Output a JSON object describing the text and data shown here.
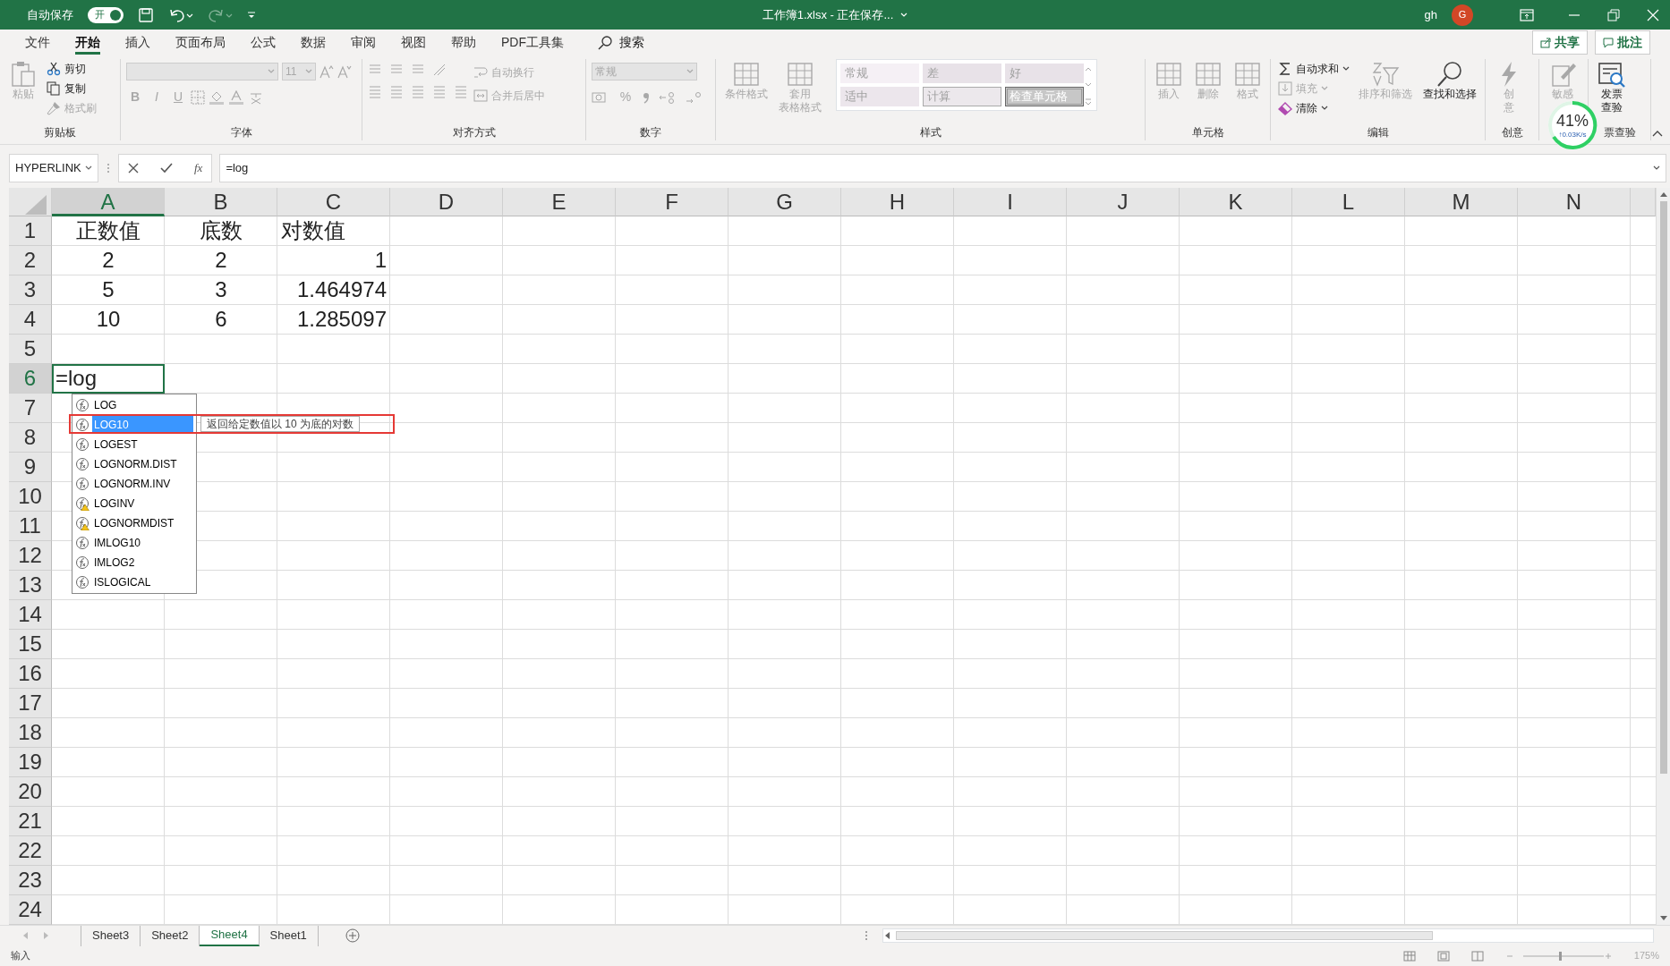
{
  "title_bar": {
    "autosave_label": "自动保存",
    "autosave": {
      "label": "开",
      "on": true
    },
    "title": "工作簿1.xlsx - 正在保存...",
    "user": "gh",
    "avatar": "G"
  },
  "menu": {
    "tabs": [
      {
        "label": "文件",
        "selected": false
      },
      {
        "label": "开始",
        "selected": true
      },
      {
        "label": "插入",
        "selected": false
      },
      {
        "label": "页面布局",
        "selected": false
      },
      {
        "label": "公式",
        "selected": false
      },
      {
        "label": "数据",
        "selected": false
      },
      {
        "label": "审阅",
        "selected": false
      },
      {
        "label": "视图",
        "selected": false
      },
      {
        "label": "帮助",
        "selected": false
      },
      {
        "label": "PDF工具集",
        "selected": false
      }
    ],
    "search": "搜索",
    "share": "共享",
    "comments": "批注"
  },
  "ribbon": {
    "groups": [
      {
        "kind": "clipboard",
        "label": "剪贴板",
        "large": {
          "lines": [
            "粘贴"
          ],
          "disabled": true
        },
        "small": [
          {
            "label": "剪切",
            "disabled": false
          },
          {
            "label": "复制",
            "disabled": false
          },
          {
            "label": "格式刷",
            "disabled": true
          }
        ]
      },
      {
        "kind": "font",
        "label": "字体",
        "font_size": "11",
        "glyphs": [
          "B",
          "I",
          "U"
        ]
      },
      {
        "kind": "alignment",
        "label": "对齐方式",
        "small": [
          {
            "label": "自动换行",
            "disabled": true
          },
          {
            "label": "合并后居中",
            "disabled": true
          }
        ]
      },
      {
        "kind": "number",
        "label": "数字",
        "format": "常规",
        "percent": "%"
      },
      {
        "kind": "styles",
        "label": "样式",
        "large": [
          {
            "lines": [
              "条件格式"
            ],
            "disabled": true
          },
          {
            "lines": [
              "套用",
              "表格格式"
            ],
            "disabled": true
          }
        ],
        "styles": [
          {
            "label": "常规",
            "kind": "normal"
          },
          {
            "label": "差",
            "kind": "bad"
          },
          {
            "label": "好",
            "kind": "good"
          },
          {
            "label": "适中",
            "kind": "neutral"
          },
          {
            "label": "计算",
            "kind": "calc"
          },
          {
            "label": "检查单元格",
            "kind": "check"
          }
        ]
      },
      {
        "kind": "large",
        "label": "单元格",
        "large": [
          {
            "lines": [
              "插入"
            ],
            "disabled": true
          },
          {
            "lines": [
              "删除"
            ],
            "disabled": true
          },
          {
            "lines": [
              "格式"
            ],
            "disabled": true
          }
        ]
      },
      {
        "kind": "editing",
        "label": "编辑",
        "small": [
          {
            "label": "自动求和",
            "disabled": false
          },
          {
            "label": "填充",
            "disabled": true
          },
          {
            "label": "清除",
            "disabled": false
          }
        ],
        "large": [
          {
            "lines": [
              "排序和筛选"
            ],
            "disabled": true
          },
          {
            "lines": [
              "查找和选择"
            ],
            "disabled": false
          }
        ]
      },
      {
        "kind": "large",
        "label": "创意",
        "large": [
          {
            "lines": [
              "创",
              "意"
            ],
            "disabled": true
          }
        ]
      },
      {
        "kind": "large",
        "large": [
          {
            "lines": [
              "敏感"
            ],
            "disabled": true
          }
        ]
      },
      {
        "kind": "large",
        "label": "票查验",
        "large": [
          {
            "lines": [
              "发票",
              "查验"
            ],
            "disabled": false
          }
        ]
      }
    ]
  },
  "formula_bar": {
    "name_box": "HYPERLINK",
    "fx": "fx",
    "formula": "=log"
  },
  "sheet": {
    "columns": [
      {
        "label": "A",
        "selected": true
      },
      {
        "label": "B",
        "selected": false
      },
      {
        "label": "C",
        "selected": false
      },
      {
        "label": "D",
        "selected": false
      },
      {
        "label": "E",
        "selected": false
      },
      {
        "label": "F",
        "selected": false
      },
      {
        "label": "G",
        "selected": false
      },
      {
        "label": "H",
        "selected": false
      },
      {
        "label": "I",
        "selected": false
      },
      {
        "label": "J",
        "selected": false
      },
      {
        "label": "K",
        "selected": false
      },
      {
        "label": "L",
        "selected": false
      },
      {
        "label": "M",
        "selected": false
      },
      {
        "label": "N",
        "selected": false
      }
    ],
    "rows": [
      {
        "label": "1",
        "selected": false,
        "cells": [
          {
            "text": "正数值",
            "kind": "text"
          },
          {
            "text": "底数",
            "kind": "text"
          },
          {
            "text": "对数值",
            "kind": "text"
          }
        ]
      },
      {
        "label": "2",
        "selected": false,
        "cells": [
          {
            "text": "2",
            "kind": "number"
          },
          {
            "text": "2",
            "kind": "number"
          },
          {
            "text": "1",
            "kind": "number"
          }
        ]
      },
      {
        "label": "3",
        "selected": false,
        "cells": [
          {
            "text": "5",
            "kind": "number"
          },
          {
            "text": "3",
            "kind": "number"
          },
          {
            "text": "1.464974",
            "kind": "number"
          }
        ]
      },
      {
        "label": "4",
        "selected": false,
        "cells": [
          {
            "text": "10",
            "kind": "number"
          },
          {
            "text": "6",
            "kind": "number"
          },
          {
            "text": "1.285097",
            "kind": "number"
          }
        ]
      },
      {
        "label": "5",
        "selected": false
      },
      {
        "label": "6",
        "selected": true,
        "cells": [
          {
            "text": "=log",
            "kind": "formula",
            "active": true
          }
        ]
      },
      {
        "label": "7",
        "selected": false
      },
      {
        "label": "8",
        "selected": false
      },
      {
        "label": "9",
        "selected": false
      },
      {
        "label": "10",
        "selected": false
      },
      {
        "label": "11",
        "selected": false
      },
      {
        "label": "12",
        "selected": false
      },
      {
        "label": "13",
        "selected": false
      },
      {
        "label": "14",
        "selected": false
      },
      {
        "label": "15",
        "selected": false
      },
      {
        "label": "16",
        "selected": false
      },
      {
        "label": "17",
        "selected": false
      },
      {
        "label": "18",
        "selected": false
      },
      {
        "label": "19",
        "selected": false
      },
      {
        "label": "20",
        "selected": false
      },
      {
        "label": "21",
        "selected": false
      },
      {
        "label": "22",
        "selected": false
      },
      {
        "label": "23",
        "selected": false
      },
      {
        "label": "24",
        "selected": false
      }
    ]
  },
  "autocomplete": {
    "items": [
      {
        "label": "LOG",
        "kind": "function",
        "selected": false
      },
      {
        "label": "LOG10",
        "kind": "function",
        "selected": true
      },
      {
        "label": "LOGEST",
        "kind": "function",
        "selected": false
      },
      {
        "label": "LOGNORM.DIST",
        "kind": "function",
        "selected": false
      },
      {
        "label": "LOGNORM.INV",
        "kind": "function",
        "selected": false
      },
      {
        "label": "LOGINV",
        "kind": "compat",
        "selected": false
      },
      {
        "label": "LOGNORMDIST",
        "kind": "compat",
        "selected": false
      },
      {
        "label": "IMLOG10",
        "kind": "function",
        "selected": false
      },
      {
        "label": "IMLOG2",
        "kind": "function",
        "selected": false
      },
      {
        "label": "ISLOGICAL",
        "kind": "function",
        "selected": false
      }
    ],
    "tooltip": "返回给定数值以 10 为底的对数"
  },
  "network_widget": {
    "percent": "41%",
    "speed": "↑0.03K/s"
  },
  "sheet_tabs": [
    {
      "label": "Sheet3",
      "selected": false
    },
    {
      "label": "Sheet2",
      "selected": false
    },
    {
      "label": "Sheet4",
      "selected": true
    },
    {
      "label": "Sheet1",
      "selected": false
    }
  ],
  "status_bar": {
    "mode": "输入",
    "zoom": "175%"
  }
}
